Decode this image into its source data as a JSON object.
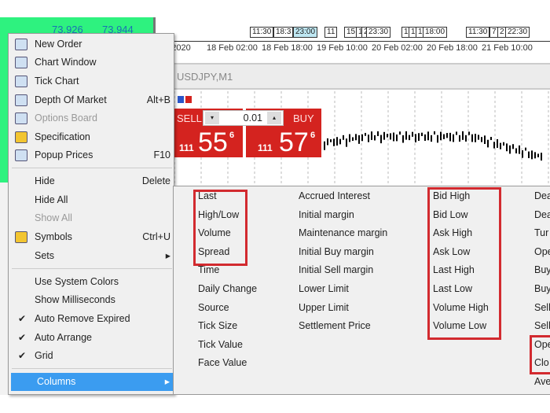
{
  "market_watch": {
    "bid": "73.926",
    "ask": "73.944"
  },
  "chart_top": {
    "axis_labels": [
      "eb 2020",
      "18 Feb 02:00",
      "18 Feb 18:00",
      "19 Feb 10:00",
      "20 Feb 02:00",
      "20 Feb 18:00",
      "21 Feb 10:00"
    ],
    "events": [
      "11:30",
      "18:3",
      "23:00",
      "11",
      "15",
      "1",
      "2",
      "23:30",
      "1",
      "1",
      "1",
      "18:00",
      "11:30",
      "7",
      "2",
      "22:30"
    ]
  },
  "chart": {
    "title": "USDJPY,M1"
  },
  "trade_panel": {
    "sell_label": "SELL",
    "buy_label": "BUY",
    "lot": "0.01",
    "sell_prefix": "111",
    "sell_big": "55",
    "sell_sup": "6",
    "buy_prefix": "111",
    "buy_big": "57",
    "buy_sup": "6",
    "color": "#d4231f"
  },
  "context_menu": {
    "items": [
      {
        "label": "New Order",
        "shortcut": "",
        "icon": "new-order-icon"
      },
      {
        "label": "Chart Window",
        "shortcut": "",
        "icon": "chart-window-icon"
      },
      {
        "label": "Tick Chart",
        "shortcut": "",
        "icon": "tick-chart-icon"
      },
      {
        "label": "Depth Of Market",
        "shortcut": "Alt+B",
        "icon": "depth-of-market-icon"
      },
      {
        "label": "Options Board",
        "shortcut": "",
        "icon": "options-board-icon",
        "disabled": true
      },
      {
        "label": "Specification",
        "shortcut": "",
        "icon": "specification-icon"
      },
      {
        "label": "Popup Prices",
        "shortcut": "F10",
        "icon": "popup-prices-icon"
      },
      {
        "label": "Hide",
        "shortcut": "Delete"
      },
      {
        "label": "Hide All",
        "shortcut": ""
      },
      {
        "label": "Show All",
        "shortcut": "",
        "disabled": true
      },
      {
        "label": "Symbols",
        "shortcut": "Ctrl+U",
        "icon": "symbols-icon"
      },
      {
        "label": "Sets",
        "shortcut": "▸"
      },
      {
        "label": "Use System Colors",
        "shortcut": ""
      },
      {
        "label": "Show Milliseconds",
        "shortcut": ""
      },
      {
        "label": "Auto Remove Expired",
        "shortcut": "",
        "checked": true
      },
      {
        "label": "Auto Arrange",
        "shortcut": "",
        "checked": true
      },
      {
        "label": "Grid",
        "shortcut": "",
        "checked": true
      },
      {
        "label": "Columns",
        "shortcut": "▸",
        "highlighted": true
      }
    ],
    "check_mark": "✔"
  },
  "columns_submenu": {
    "col1": [
      "Last",
      "High/Low",
      "Volume",
      "Spread",
      "Time",
      "Daily Change",
      "Source",
      "Tick Size",
      "Tick Value",
      "Face Value"
    ],
    "col2": [
      "Accrued Interest",
      "Initial margin",
      "Maintenance margin",
      "Initial Buy margin",
      "Initial Sell margin",
      "Lower Limit",
      "Upper Limit",
      "Settlement Price"
    ],
    "col3": [
      "Bid High",
      "Bid Low",
      "Ask High",
      "Ask Low",
      "Last High",
      "Last Low",
      "Volume High",
      "Volume Low"
    ],
    "col4": [
      "Dea",
      "Dea",
      "Tur",
      "Ope",
      "Buy",
      "Buy",
      "Sell",
      "Sell",
      "Ope",
      "Clo",
      "Ave"
    ],
    "highlight_color": "#d22a2f"
  }
}
